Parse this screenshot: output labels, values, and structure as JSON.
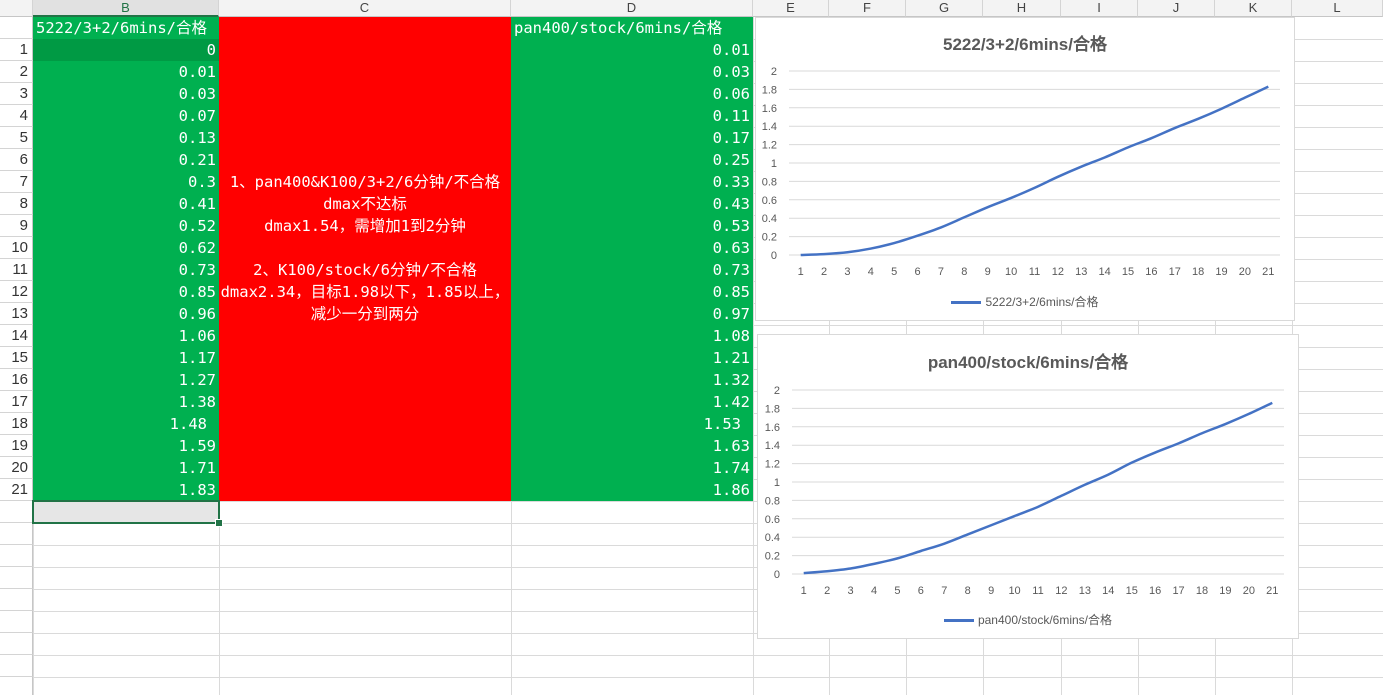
{
  "columns": [
    {
      "id": "col-blank",
      "label": ""
    },
    {
      "id": "col-b",
      "label": "B"
    },
    {
      "id": "col-c",
      "label": "C"
    },
    {
      "id": "col-d",
      "label": "D"
    },
    {
      "id": "col-e",
      "label": "E"
    },
    {
      "id": "col-f",
      "label": "F"
    },
    {
      "id": "col-g",
      "label": "G"
    },
    {
      "id": "col-h",
      "label": "H"
    },
    {
      "id": "col-i",
      "label": "I"
    },
    {
      "id": "col-j",
      "label": "J"
    },
    {
      "id": "col-k",
      "label": "K"
    },
    {
      "id": "col-l",
      "label": "L"
    }
  ],
  "row_numbers": [
    "1",
    "2",
    "3",
    "4",
    "5",
    "6",
    "7",
    "8",
    "9",
    "10",
    "11",
    "12",
    "13",
    "14",
    "15",
    "16",
    "17",
    "18",
    "19",
    "20",
    "21"
  ],
  "header_row": {
    "b": "5222/3+2/6mins/合格",
    "d": "pan400/stock/6mins/合格"
  },
  "column_b": [
    "0",
    "0.01",
    "0.03",
    "0.07",
    "0.13",
    "0.21",
    "0.3",
    "0.41",
    "0.52",
    "0.62",
    "0.73",
    "0.85",
    "0.96",
    "1.06",
    "1.17",
    "1.27",
    "1.38",
    "1.48",
    "1.59",
    "1.71",
    "1.83"
  ],
  "column_d": [
    "0.01",
    "0.03",
    "0.06",
    "0.11",
    "0.17",
    "0.25",
    "0.33",
    "0.43",
    "0.53",
    "0.63",
    "0.73",
    "0.85",
    "0.97",
    "1.08",
    "1.21",
    "1.32",
    "1.42",
    "1.53",
    "1.63",
    "1.74",
    "1.86"
  ],
  "note_c": [
    "1、pan400&K100/3+2/6分钟/不合格",
    "dmax不达标",
    "dmax1.54，需增加1到2分钟",
    "",
    "2、K100/stock/6分钟/不合格",
    "dmax2.34，目标1.98以下，1.85以上，减少一分到两分"
  ],
  "colors": {
    "green_fill": "#00b050",
    "green_dark_fill": "#009a44",
    "red_fill": "#ff0000",
    "line": "#4472c4",
    "selection": "#217346"
  },
  "chart_data": [
    {
      "type": "line",
      "title": "5222/3+2/6mins/合格",
      "categories": [
        "1",
        "2",
        "3",
        "4",
        "5",
        "6",
        "7",
        "8",
        "9",
        "10",
        "11",
        "12",
        "13",
        "14",
        "15",
        "16",
        "17",
        "18",
        "19",
        "20",
        "21"
      ],
      "series": [
        {
          "name": "5222/3+2/6mins/合格",
          "values": [
            0,
            0.01,
            0.03,
            0.07,
            0.13,
            0.21,
            0.3,
            0.41,
            0.52,
            0.62,
            0.73,
            0.85,
            0.96,
            1.06,
            1.17,
            1.27,
            1.38,
            1.48,
            1.59,
            1.71,
            1.83
          ]
        }
      ],
      "ylim": [
        0,
        2
      ],
      "yticks": [
        "0",
        "0.2",
        "0.4",
        "0.6",
        "0.8",
        "1",
        "1.2",
        "1.4",
        "1.6",
        "1.8",
        "2"
      ],
      "grid": true,
      "legend": "bottom"
    },
    {
      "type": "line",
      "title": "pan400/stock/6mins/合格",
      "categories": [
        "1",
        "2",
        "3",
        "4",
        "5",
        "6",
        "7",
        "8",
        "9",
        "10",
        "11",
        "12",
        "13",
        "14",
        "15",
        "16",
        "17",
        "18",
        "19",
        "20",
        "21"
      ],
      "series": [
        {
          "name": "pan400/stock/6mins/合格",
          "values": [
            0.01,
            0.03,
            0.06,
            0.11,
            0.17,
            0.25,
            0.33,
            0.43,
            0.53,
            0.63,
            0.73,
            0.85,
            0.97,
            1.08,
            1.21,
            1.32,
            1.42,
            1.53,
            1.63,
            1.74,
            1.86
          ]
        }
      ],
      "ylim": [
        0,
        2
      ],
      "yticks": [
        "0",
        "0.2",
        "0.4",
        "0.6",
        "0.8",
        "1",
        "1.2",
        "1.4",
        "1.6",
        "1.8",
        "2"
      ],
      "grid": true,
      "legend": "bottom"
    }
  ]
}
